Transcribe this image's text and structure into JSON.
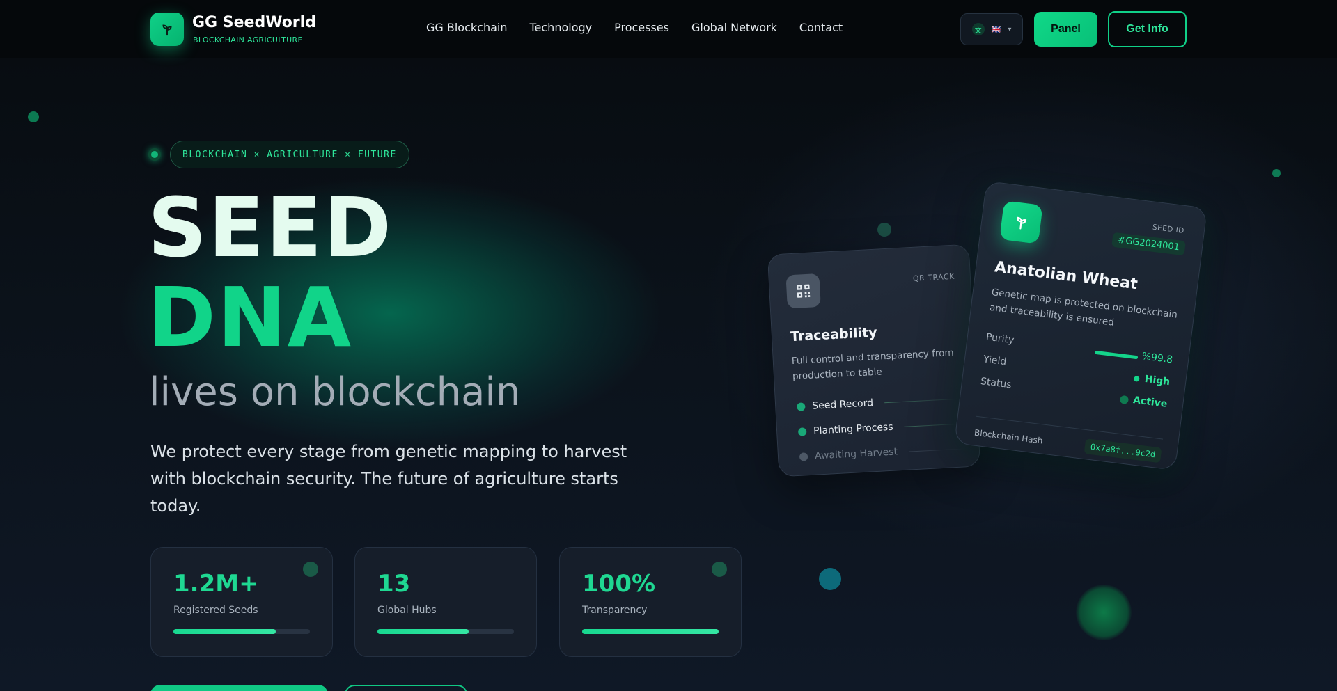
{
  "header": {
    "brand": "GG SeedWorld",
    "brand_sub": "BLOCKCHAIN AGRICULTURE",
    "nav": [
      "GG Blockchain",
      "Technology",
      "Processes",
      "Global Network",
      "Contact"
    ],
    "lang_flag": "🇬🇧",
    "panel_label": "Panel",
    "info_label": "Get Info"
  },
  "hero": {
    "badge": "BLOCKCHAIN × AGRICULTURE × FUTURE",
    "line1": "SEED",
    "line2": "DNA",
    "line3": "lives on blockchain",
    "description": "We protect every stage from genetic mapping to harvest with blockchain security. The future of agriculture starts today."
  },
  "stats": [
    {
      "value": "1.2M+",
      "label": "Registered Seeds",
      "progress": 0.75
    },
    {
      "value": "13",
      "label": "Global Hubs",
      "progress": 0.67
    },
    {
      "value": "100%",
      "label": "Transparency",
      "progress": 1.0
    }
  ],
  "trace_card": {
    "tag": "QR TRACK",
    "title": "Traceability",
    "text": "Full control and transparency from production to table",
    "items": [
      {
        "label": "Seed Record",
        "state": "done"
      },
      {
        "label": "Planting Process",
        "state": "done"
      },
      {
        "label": "Awaiting Harvest",
        "state": "pending"
      }
    ]
  },
  "seed_card": {
    "id_label": "SEED ID",
    "id_value": "#GG2024001",
    "title": "Anatolian Wheat",
    "text": "Genetic map is protected on blockchain and traceability is ensured",
    "rows": [
      {
        "label": "Purity",
        "value": "%99.8"
      },
      {
        "label": "Yield",
        "value": "High"
      },
      {
        "label": "Status",
        "value": "Active"
      }
    ],
    "hash_label": "Blockchain Hash",
    "hash_value": "0x7a8f...9c2d"
  },
  "colors": {
    "accent": "#10d088",
    "accent_text": "#2ee59a",
    "background": "#0b121a"
  },
  "icons": {
    "logo": "sprout-icon",
    "trace": "qr-code-icon",
    "seed": "sprout-icon",
    "lang": "translate-icon"
  }
}
